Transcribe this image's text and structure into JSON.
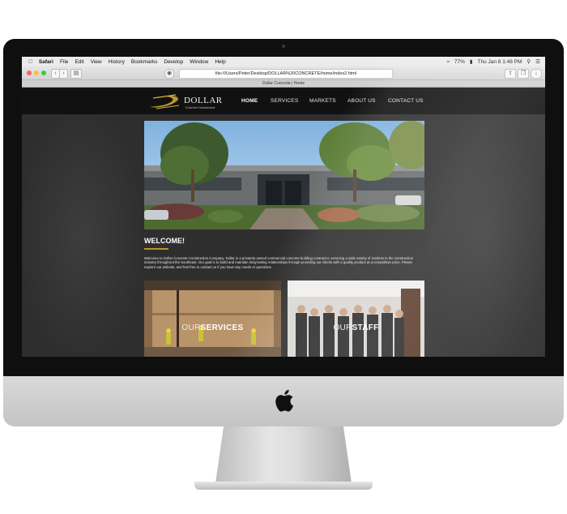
{
  "macos": {
    "menu": [
      "Safari",
      "File",
      "Edit",
      "View",
      "History",
      "Bookmarks",
      "Develop",
      "Window",
      "Help"
    ],
    "battery": "77%",
    "datetime": "Thu Jan 8  1:48 PM"
  },
  "browser": {
    "url": "file:///Users/Peter/Desktop/DOLLAR%20CONCRETE/home/index2.html",
    "tab_title": "Dollar Concrete | Home"
  },
  "site": {
    "logo_name": "DOLLAR",
    "logo_tagline": "Concrete Construction",
    "nav": [
      "HOME",
      "SERVICES",
      "MARKETS",
      "ABOUT US",
      "CONTACT US"
    ],
    "welcome_title": "WELCOME!",
    "welcome_text": "Welcome to Dollar Concrete Construction Company. Dollar is a privately-owned commercial concrete building contractor, servicing a wide variety of markets in the construction industry throughout the Southeast. Our goal is to build and maintain long-lasting relationships through providing our clients with a quality product at a competitive price. Please explore our website, and feel free to contact us if you have any needs or questions.",
    "tiles": [
      {
        "light": "OUR",
        "bold": "SERVICES"
      },
      {
        "light": "OUR",
        "bold": "STAFF"
      }
    ]
  },
  "colors": {
    "accent": "#b8962e",
    "header_bg": "#111111",
    "page_bg": "#2e2e2e"
  }
}
